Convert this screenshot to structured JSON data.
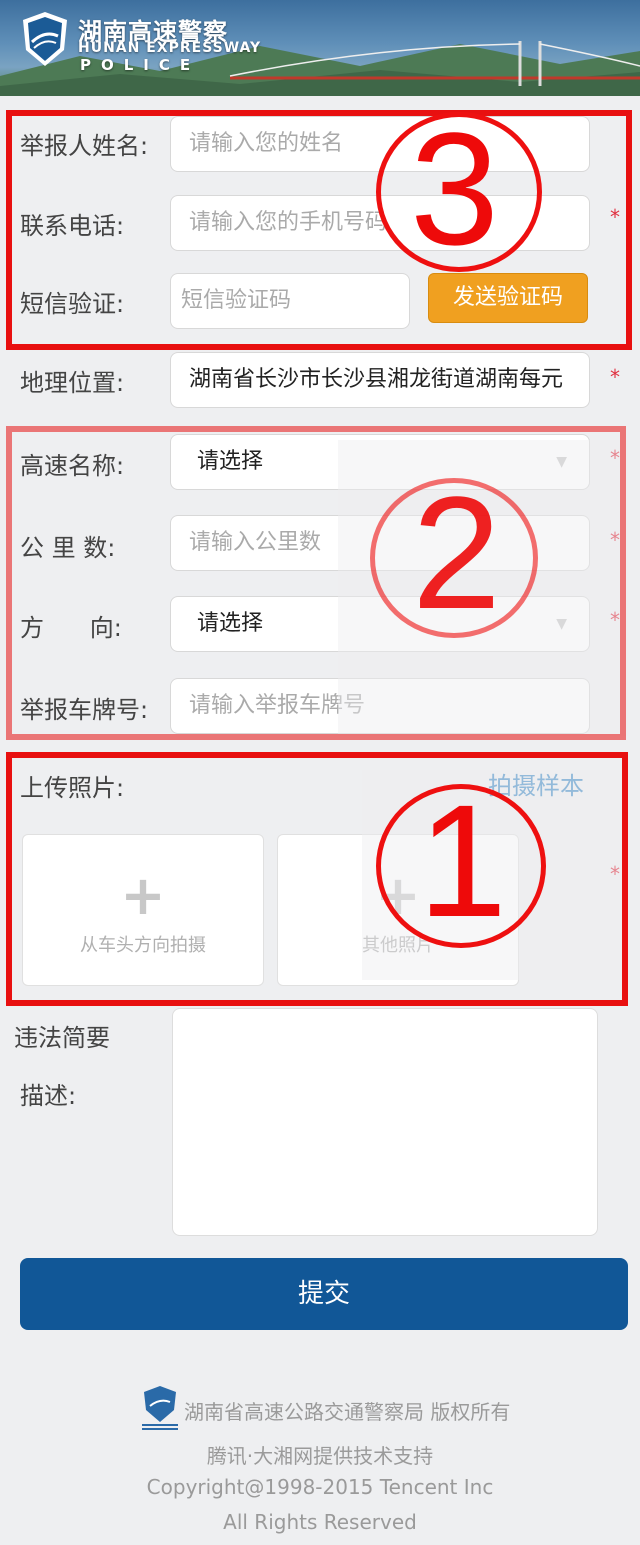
{
  "header": {
    "title_cn": "湖南高速警察",
    "title_en": "HUNAN EXPRESSWAY",
    "title_police": "POLICE"
  },
  "form": {
    "reporter_name": {
      "label": "举报人姓名:",
      "placeholder": "请输入您的姓名"
    },
    "phone": {
      "label": "联系电话:",
      "placeholder": "请输入您的手机号码"
    },
    "sms": {
      "label": "短信验证:",
      "placeholder": "短信验证码",
      "button": "发送验证码"
    },
    "location": {
      "label": "地理位置:",
      "value": "湖南省长沙市长沙县湘龙街道湖南每元"
    },
    "highway": {
      "label": "高速名称:",
      "value": "请选择"
    },
    "km": {
      "label": "公 里 数:",
      "placeholder": "请输入公里数"
    },
    "direction": {
      "label": "方      向:",
      "value": "请选择"
    },
    "plate": {
      "label": "举报车牌号:",
      "placeholder": "请输入举报车牌号"
    },
    "upload": {
      "label": "上传照片:",
      "sample_link": "拍摄样本",
      "box1": "从车头方向拍摄",
      "box2": "其他照片"
    },
    "description": {
      "label_line1": "违法简要",
      "label_line2": "描述:"
    },
    "submit": "提交",
    "required_mark": "*"
  },
  "footer": {
    "copyright_cn": "湖南省高速公路交通警察局 版权所有",
    "support": "腾讯·大湘网提供技术支持",
    "copyright_en": "Copyright@1998-2015 Tencent Inc",
    "rights": "All Rights Reserved"
  },
  "annotations": {
    "n1": "1",
    "n2": "2",
    "n3": "3"
  },
  "colors": {
    "accent": "#115797",
    "send_button": "#f0a020",
    "required": "#e03040",
    "annotation": "#e81010"
  }
}
